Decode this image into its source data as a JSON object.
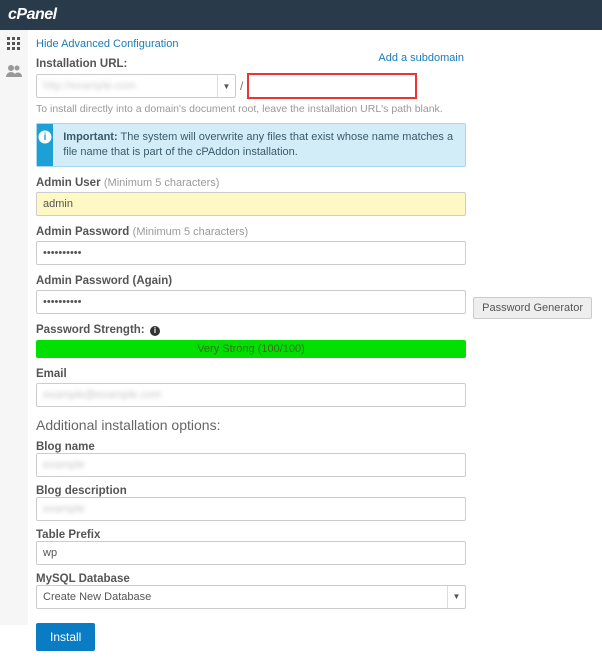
{
  "header": {
    "logo": "cPanel"
  },
  "links": {
    "hide_advanced": "Hide Advanced Configuration",
    "add_subdomain": "Add a subdomain"
  },
  "install_url": {
    "label": "Installation URL:",
    "domain_placeholder": "http://example.com",
    "slash": "/",
    "path_value": "",
    "hint": "To install directly into a domain's document root, leave the installation URL's path blank."
  },
  "callout": {
    "title": "Important:",
    "body": "The system will overwrite any files that exist whose name matches a file name that is part of the cPAddon installation."
  },
  "admin_user": {
    "label": "Admin User",
    "hint": "(Minimum 5 characters)",
    "value": "admin"
  },
  "admin_pw": {
    "label": "Admin Password",
    "hint": "(Minimum 5 characters)",
    "value": "••••••••••"
  },
  "admin_pw2": {
    "label": "Admin Password (Again)",
    "value": "••••••••••"
  },
  "strength": {
    "label": "Password Strength:",
    "value": "Very Strong (100/100)"
  },
  "pw_gen_btn": "Password Generator",
  "email": {
    "label": "Email",
    "value": "example@example.com"
  },
  "additional_title": "Additional installation options:",
  "blog_name": {
    "label": "Blog name",
    "value": "example"
  },
  "blog_desc": {
    "label": "Blog description",
    "value": "example"
  },
  "table_prefix": {
    "label": "Table Prefix",
    "value": "wp"
  },
  "mysql": {
    "label": "MySQL Database",
    "value": "Create New Database"
  },
  "install_btn": "Install"
}
